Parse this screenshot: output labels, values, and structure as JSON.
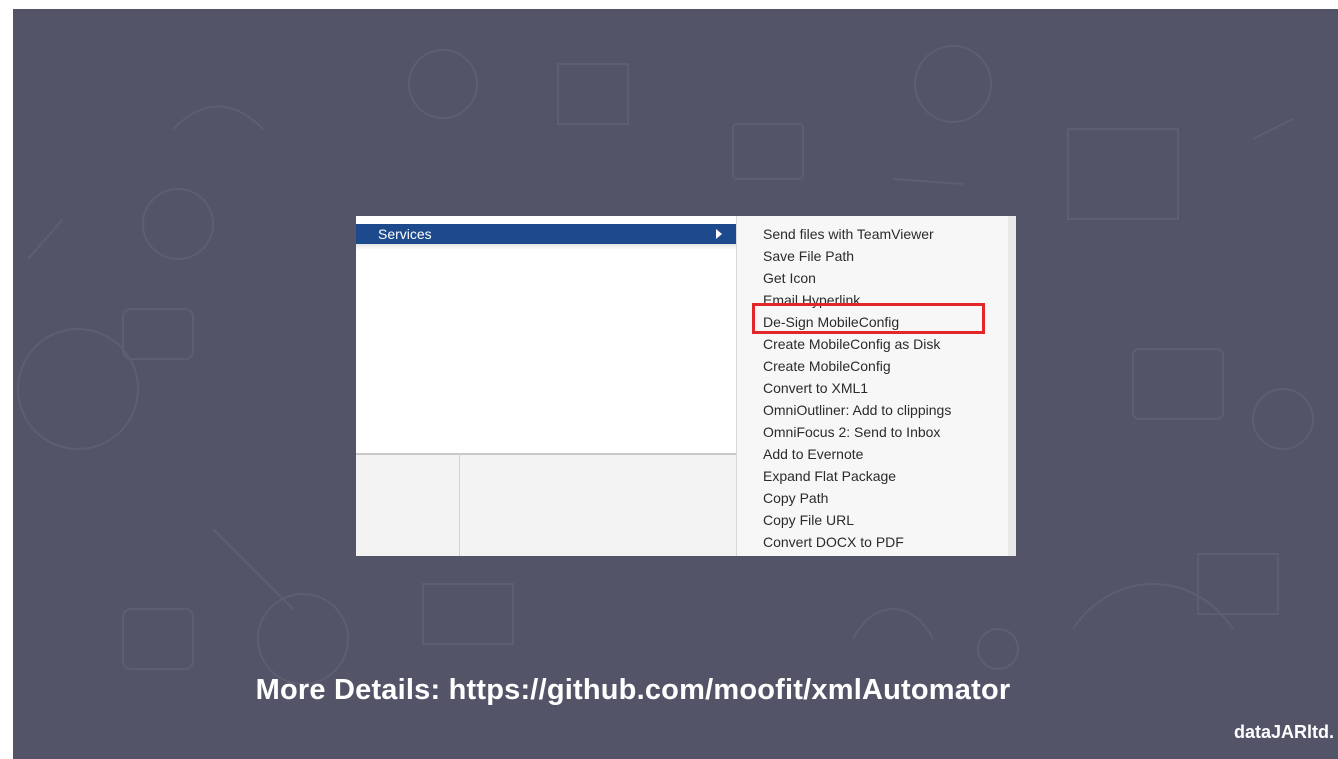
{
  "submenu": {
    "parent_label": "Services",
    "items": [
      "Send files with TeamViewer",
      "Save File Path",
      "Get Icon",
      "Email Hyperlink",
      "De-Sign MobileConfig",
      "Create MobileConfig as Disk",
      "Create MobileConfig",
      "Convert to XML1",
      "OmniOutliner: Add to clippings",
      "OmniFocus 2: Send to Inbox",
      "Add to Evernote",
      "Expand Flat Package",
      "Copy Path",
      "Copy File URL",
      "Convert DOCX to PDF"
    ],
    "highlighted_item": "De-Sign MobileConfig"
  },
  "footer": {
    "details": "More Details: https://github.com/moofit/xmlAutomator"
  },
  "brand": {
    "name": "dataJARltd."
  },
  "colors": {
    "slide_background": "#535468",
    "menu_selection": "#1d4a8c",
    "highlight_border": "#e2262a"
  }
}
